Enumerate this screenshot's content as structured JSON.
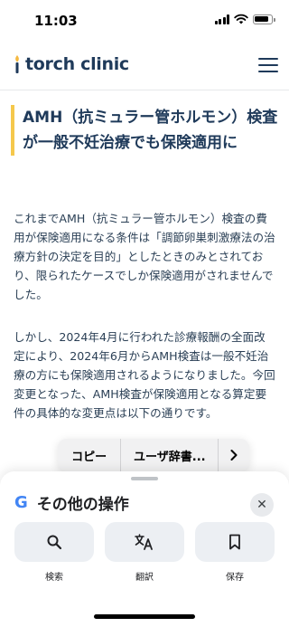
{
  "status_bar": {
    "time": "11:03",
    "battery_level": 0.85
  },
  "header": {
    "logo_text": "torch clinic",
    "menu_icon": "hamburger-icon",
    "brand_color": "#1f3a5a",
    "accent_color": "#f5c84c"
  },
  "article": {
    "title": "AMH（抗ミュラー管ホルモン）検査が一般不妊治療でも保険適用に",
    "paragraphs": [
      "これまでAMH（抗ミュラー管ホルモン）検査の費用が保険適用になる条件は「調節卵巣刺激療法の治療方針の決定を目的」としたときのみとされており、限られたケースでしか保険適用がされませんでした。",
      "しかし、2024年4月に行われた診療報酬の全面改定により、2024年6月からAMH検査は一般不妊治療の方にも保険適用されるようになりました。今回変更となった、AMH検査が保険適用となる算定要件の具体的な変更点は以下の通りです。"
    ]
  },
  "context_menu": {
    "copy": "コピー",
    "dictionary": "ユーザ辞書...",
    "next_icon": "chevron-right-icon"
  },
  "sheet": {
    "title": "その他の操作",
    "google_logo": "G",
    "close_icon": "close-icon",
    "actions": [
      {
        "label": "検索",
        "icon": "search-icon"
      },
      {
        "label": "翻訳",
        "icon": "translate-icon"
      },
      {
        "label": "保存",
        "icon": "bookmark-icon"
      }
    ]
  }
}
